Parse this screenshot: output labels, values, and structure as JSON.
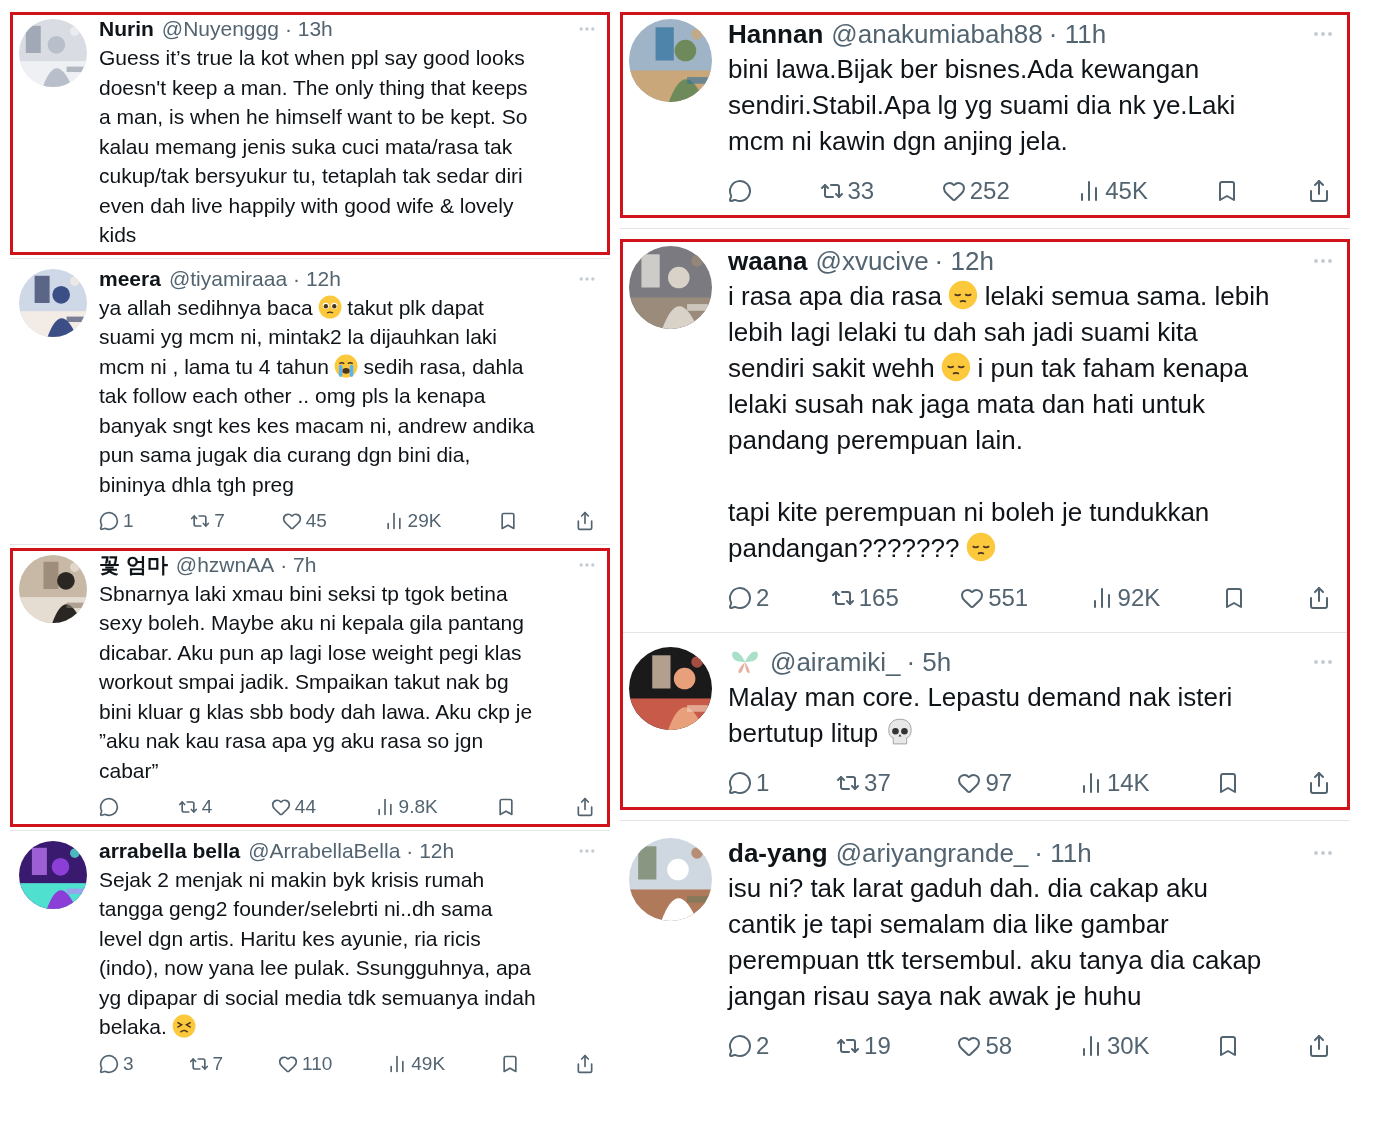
{
  "columns": [
    {
      "groups": [
        {
          "highlighted": true,
          "tweets": [
            {
              "name": "Nurin",
              "handle": "@Nuyenggg",
              "time": "· 13h",
              "lines": [
                [
                  {
                    "text": "Guess it’s true la kot when ppl say good looks"
                  }
                ],
                [
                  {
                    "text": "doesn't keep a man. The only thing that keeps"
                  }
                ],
                [
                  {
                    "text": "a man, is when he himself want to be kept. So"
                  }
                ],
                [
                  {
                    "text": "kalau memang jenis suka cuci mata/rasa tak"
                  }
                ],
                [
                  {
                    "text": "cukup/tak bersyukur tu, tetaplah tak sedar diri"
                  }
                ],
                [
                  {
                    "text": "even dah live happily with good wife & lovely"
                  }
                ],
                [
                  {
                    "text": "kids"
                  }
                ]
              ]
            }
          ]
        },
        {
          "highlighted": false,
          "tweets": [
            {
              "name": "meera",
              "handle": "@tiyamiraaa",
              "time": "· 12h",
              "lines": [
                [
                  {
                    "text": "ya allah sedihnya baca"
                  },
                  {
                    "kind": "pleading"
                  },
                  {
                    "text": "takut plk dapat"
                  }
                ],
                [
                  {
                    "text": "suami yg mcm ni, mintak2 la dijauhkan laki"
                  }
                ],
                [
                  {
                    "text": "mcm ni , lama tu 4 tahun"
                  },
                  {
                    "kind": "sob"
                  },
                  {
                    "text": "sedih rasa, dahla"
                  }
                ],
                [
                  {
                    "text": "tak follow each other .. omg pls la kenapa"
                  }
                ],
                [
                  {
                    "text": "banyak sngt kes kes macam ni, andrew andika"
                  }
                ],
                [
                  {
                    "text": "pun sama jugak dia curang dgn bini dia,"
                  }
                ],
                [
                  {
                    "text": "bininya dhla tgh preg"
                  }
                ]
              ],
              "stats": {
                "replies": "1",
                "retweets": "7",
                "likes": "45",
                "views": "29K"
              }
            }
          ]
        },
        {
          "highlighted": true,
          "tweets": [
            {
              "name": "꽃 엄마",
              "handle": "@hzwnAA",
              "time": "· 7h",
              "lines": [
                [
                  {
                    "text": "Sbnarnya laki xmau bini seksi tp tgok betina"
                  }
                ],
                [
                  {
                    "text": "sexy boleh. Maybe aku ni kepala gila pantang"
                  }
                ],
                [
                  {
                    "text": "dicabar. Aku pun ap lagi lose weight pegi klas"
                  }
                ],
                [
                  {
                    "text": "workout smpai jadik. Smpaikan takut nak bg"
                  }
                ],
                [
                  {
                    "text": "bini kluar g klas sbb body dah lawa. Aku ckp je"
                  }
                ],
                [
                  {
                    "text": "”aku nak kau rasa apa yg aku rasa so jgn"
                  }
                ],
                [
                  {
                    "text": "cabar”"
                  }
                ]
              ],
              "stats": {
                "retweets": "4",
                "likes": "44",
                "views": "9.8K"
              }
            }
          ]
        },
        {
          "highlighted": false,
          "tweets": [
            {
              "name": "arrabella bella",
              "handle": "@ArrabellaBella",
              "time": "· 12h",
              "lines": [
                [
                  {
                    "text": "Sejak 2 menjak ni makin byk krisis rumah"
                  }
                ],
                [
                  {
                    "text": "tangga geng2 founder/selebrti ni..dh sama"
                  }
                ],
                [
                  {
                    "text": "level dgn artis. Haritu kes ayunie, ria ricis"
                  }
                ],
                [
                  {
                    "text": "(indo), now yana lee pulak. Ssungguhnya, apa"
                  }
                ],
                [
                  {
                    "text": "yg dipapar di social media tdk semuanya indah"
                  }
                ],
                [
                  {
                    "text": "belaka."
                  },
                  {
                    "kind": "persevere"
                  }
                ]
              ],
              "stats": {
                "replies": "3",
                "retweets": "7",
                "likes": "110",
                "views": "49K"
              }
            }
          ]
        }
      ]
    },
    {
      "groups": [
        {
          "highlighted": true,
          "tweets": [
            {
              "name": "Hannan",
              "handle": "@anakumiabah88",
              "time": "· 11h",
              "lines": [
                [
                  {
                    "text": "bini lawa.Bijak ber bisnes.Ada kewangan"
                  }
                ],
                [
                  {
                    "text": "sendiri.Stabil.Apa lg yg suami dia nk ye.Laki"
                  }
                ],
                [
                  {
                    "text": "mcm ni kawin dgn anjing jela."
                  }
                ]
              ],
              "stats": {
                "retweets": "33",
                "likes": "252",
                "views": "45K"
              }
            }
          ]
        },
        {
          "highlighted": true,
          "tweets": [
            {
              "name": "waana",
              "handle": "@xvucive",
              "time": "· 12h",
              "lines": [
                [
                  {
                    "text": "i rasa apa dia rasa"
                  },
                  {
                    "kind": "pensive"
                  },
                  {
                    "text": "lelaki semua sama. lebih"
                  }
                ],
                [
                  {
                    "text": "lebih lagi lelaki tu dah sah jadi suami kita"
                  }
                ],
                [
                  {
                    "text": "sendiri sakit wehh"
                  },
                  {
                    "kind": "pensive"
                  },
                  {
                    "text": "i pun tak faham kenapa"
                  }
                ],
                [
                  {
                    "text": "lelaki susah nak jaga mata dan hati untuk"
                  }
                ],
                [
                  {
                    "text": "pandang perempuan lain."
                  }
                ]
              ],
              "more_lines": [
                [
                  {
                    "text": "tapi kite perempuan ni boleh je tundukkan"
                  }
                ],
                [
                  {
                    "text": "pandangan???????"
                  },
                  {
                    "kind": "pensive"
                  }
                ]
              ],
              "stats": {
                "replies": "2",
                "retweets": "165",
                "likes": "551",
                "views": "92K"
              }
            },
            {
              "handle": "@airamiki_",
              "time": "· 5h",
              "lines": [
                [
                  {
                    "text": "Malay man core. Lepastu demand nak isteri"
                  }
                ],
                [
                  {
                    "text": "bertutup litup"
                  },
                  {
                    "kind": "skull"
                  }
                ]
              ],
              "stats": {
                "replies": "1",
                "retweets": "37",
                "likes": "97",
                "views": "14K"
              }
            }
          ]
        },
        {
          "highlighted": false,
          "tweets": [
            {
              "name": "da-yang",
              "handle": "@ariyangrande_",
              "time": "· 11h",
              "lines": [
                [
                  {
                    "text": "isu ni? tak larat gaduh dah. dia cakap aku"
                  }
                ],
                [
                  {
                    "text": "cantik je tapi semalam dia like gambar"
                  }
                ],
                [
                  {
                    "text": "perempuan ttk tersembul. aku tanya dia cakap"
                  }
                ],
                [
                  {
                    "text": "jangan risau saya nak awak je huhu"
                  }
                ]
              ],
              "stats": {
                "replies": "2",
                "retweets": "19",
                "likes": "58",
                "views": "30K"
              }
            }
          ]
        }
      ]
    }
  ]
}
